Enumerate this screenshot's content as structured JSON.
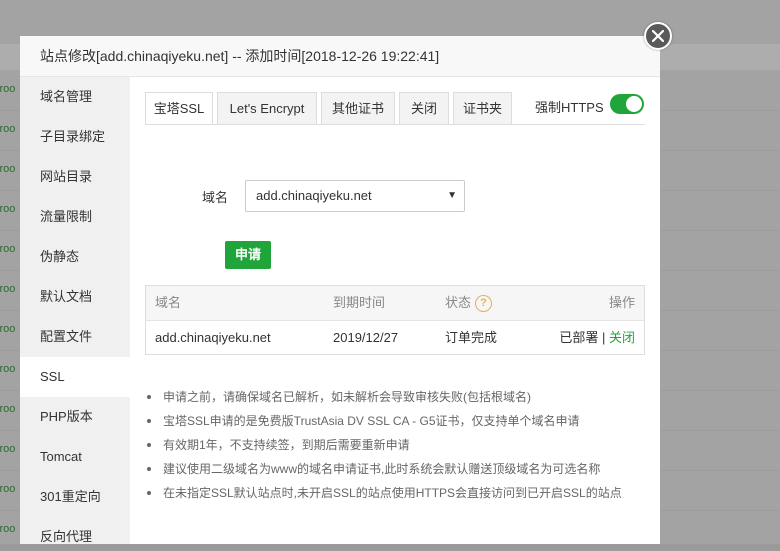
{
  "dialog": {
    "title": "站点修改[add.chinaqiyeku.net] -- 添加时间[2018-12-26 19:22:41]"
  },
  "background": {
    "row_text": "yroo"
  },
  "sidebar": {
    "items": [
      {
        "label": "域名管理",
        "active": false
      },
      {
        "label": "子目录绑定",
        "active": false
      },
      {
        "label": "网站目录",
        "active": false
      },
      {
        "label": "流量限制",
        "active": false
      },
      {
        "label": "伪静态",
        "active": false
      },
      {
        "label": "默认文档",
        "active": false
      },
      {
        "label": "配置文件",
        "active": false
      },
      {
        "label": "SSL",
        "active": true
      },
      {
        "label": "PHP版本",
        "active": false
      },
      {
        "label": "Tomcat",
        "active": false
      },
      {
        "label": "301重定向",
        "active": false
      },
      {
        "label": "反向代理",
        "active": false
      }
    ]
  },
  "tabs": [
    {
      "label": "宝塔SSL",
      "active": true
    },
    {
      "label": "Let's Encrypt",
      "active": false
    },
    {
      "label": "其他证书",
      "active": false
    },
    {
      "label": "关闭",
      "active": false
    },
    {
      "label": "证书夹",
      "active": false
    }
  ],
  "https": {
    "label": "强制HTTPS",
    "enabled": true
  },
  "form": {
    "domain_label": "域名",
    "domain_value": "add.chinaqiyeku.net",
    "apply_label": "申请"
  },
  "table": {
    "headers": {
      "domain": "域名",
      "expiry": "到期时间",
      "status": "状态",
      "actions": "操作"
    },
    "rows": [
      {
        "domain": "add.chinaqiyeku.net",
        "expiry": "2019/12/27",
        "status": "订单完成",
        "deployed": "已部署",
        "separator": "|",
        "close": "关闭"
      }
    ]
  },
  "notes": [
    "申请之前，请确保域名已解析，如未解析会导致审核失败(包括根域名)",
    "宝塔SSL申请的是免费版TrustAsia DV SSL CA - G5证书，仅支持单个域名申请",
    "有效期1年，不支持续签，到期后需要重新申请",
    "建议使用二级域名为www的域名申请证书,此时系统会默认赠送顶级域名为可选名称",
    "在未指定SSL默认站点时,未开启SSL的站点使用HTTPS会直接访问到已开启SSL的站点"
  ],
  "colors": {
    "accent_green": "#20a53a",
    "warning_orange": "#f0ad4e"
  }
}
